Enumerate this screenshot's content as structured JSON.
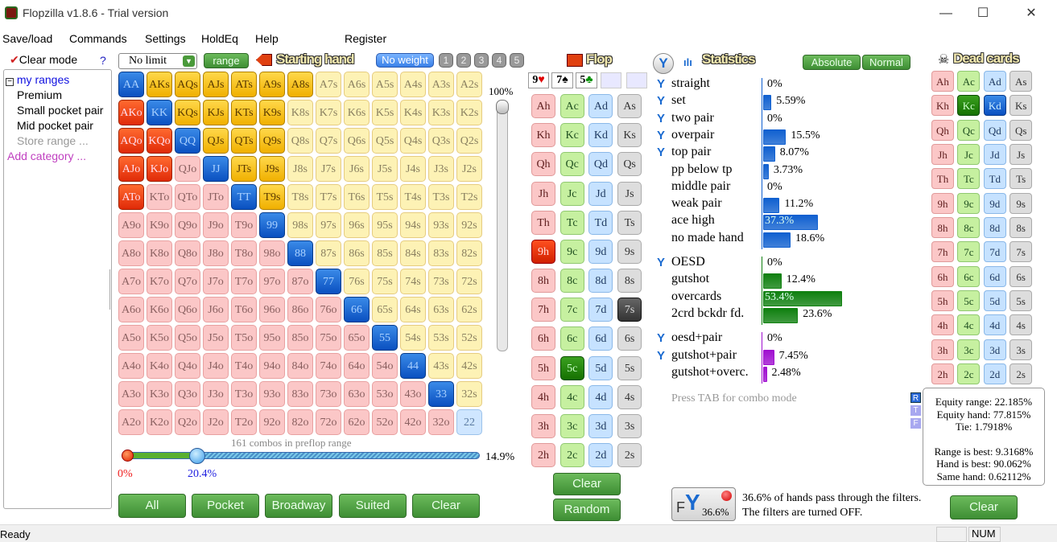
{
  "window": {
    "title": "Flopzilla v1.8.6 - Trial version",
    "minimize": "—",
    "maximize": "☐",
    "close": "✕"
  },
  "menu": [
    "Save/load",
    "Commands",
    "Settings",
    "HoldEq",
    "Help",
    "Register"
  ],
  "left": {
    "clear_mode": "Clear mode",
    "help": "?",
    "root": "my ranges",
    "items": [
      "Premium",
      "Small pocket pair",
      "Mid pocket pair"
    ],
    "store": "Store range ...",
    "add": "Add category ..."
  },
  "range_toolbar": {
    "game": "No limit",
    "range_btn": "range",
    "header": "Starting hand",
    "weight": "No weight",
    "weights": [
      "1",
      "2",
      "3",
      "4",
      "5"
    ],
    "slider_top": "100%"
  },
  "grid": {
    "ranks": [
      "A",
      "K",
      "Q",
      "J",
      "T",
      "9",
      "8",
      "7",
      "6",
      "5",
      "4",
      "3",
      "2"
    ],
    "selected": [
      "AA",
      "KK",
      "QQ",
      "JJ",
      "TT",
      "99",
      "88",
      "77",
      "66",
      "55",
      "44",
      "33",
      "AKs",
      "AQs",
      "AJs",
      "ATs",
      "A9s",
      "A8s",
      "KQs",
      "KJs",
      "KTs",
      "K9s",
      "QJs",
      "QTs",
      "Q9s",
      "JTs",
      "J9s",
      "T9s",
      "AKo",
      "AQo",
      "KQo",
      "AJo",
      "KJo",
      "ATo"
    ]
  },
  "combos_text": "161 combos in preflop range",
  "range_slider": {
    "low": "0%",
    "high": "20.4%",
    "value": "14.9%",
    "low_value": 0,
    "high_value": 20.4
  },
  "range_buttons": [
    "All",
    "Pocket",
    "Broadway",
    "Suited",
    "Clear"
  ],
  "flop": {
    "header": "Flop",
    "board": [
      {
        "rank": "9",
        "suit": "♥",
        "color": "#e00000"
      },
      {
        "rank": "7",
        "suit": "♠",
        "color": "#000"
      },
      {
        "rank": "5",
        "suit": "♣",
        "color": "#009000"
      }
    ],
    "ranks": [
      "A",
      "K",
      "Q",
      "J",
      "T",
      "9",
      "8",
      "7",
      "6",
      "5",
      "4",
      "3",
      "2"
    ],
    "suits": [
      "h",
      "c",
      "d",
      "s"
    ],
    "selected": [
      "9h",
      "5c",
      "7s"
    ],
    "clear": "Clear",
    "random": "Random"
  },
  "statistics": {
    "header": "Statistics",
    "absolute": "Absolute",
    "normal": "Normal",
    "groups": [
      {
        "color": "#1060d0",
        "rows": [
          {
            "label": "straight",
            "value": "0%",
            "pct": 0,
            "filter": true
          },
          {
            "label": "set",
            "value": "5.59%",
            "pct": 5.59,
            "filter": true
          },
          {
            "label": "two pair",
            "value": "0%",
            "pct": 0,
            "filter": true
          },
          {
            "label": "overpair",
            "value": "15.5%",
            "pct": 15.5,
            "filter": true
          },
          {
            "label": "top pair",
            "value": "8.07%",
            "pct": 8.07,
            "filter": true
          },
          {
            "label": "pp below tp",
            "value": "3.73%",
            "pct": 3.73,
            "filter": false
          },
          {
            "label": "middle pair",
            "value": "0%",
            "pct": 0,
            "filter": false
          },
          {
            "label": "weak pair",
            "value": "11.2%",
            "pct": 11.2,
            "filter": false
          },
          {
            "label": "ace high",
            "value": "37.3%",
            "pct": 37.3,
            "filter": false
          },
          {
            "label": "no made hand",
            "value": "18.6%",
            "pct": 18.6,
            "filter": false
          }
        ]
      },
      {
        "color": "#108010",
        "rows": [
          {
            "label": "OESD",
            "value": "0%",
            "pct": 0,
            "filter": true
          },
          {
            "label": "gutshot",
            "value": "12.4%",
            "pct": 12.4,
            "filter": false
          },
          {
            "label": "overcards",
            "value": "53.4%",
            "pct": 53.4,
            "filter": false
          },
          {
            "label": "2crd bckdr fd.",
            "value": "23.6%",
            "pct": 23.6,
            "filter": false
          }
        ]
      },
      {
        "color": "#a010d0",
        "rows": [
          {
            "label": "oesd+pair",
            "value": "0%",
            "pct": 0,
            "filter": true
          },
          {
            "label": "gutshot+pair",
            "value": "7.45%",
            "pct": 7.45,
            "filter": true
          },
          {
            "label": "gutshot+overc.",
            "value": "2.48%",
            "pct": 2.48,
            "filter": false
          }
        ]
      }
    ],
    "hint": "Press TAB for combo mode"
  },
  "dead": {
    "header": "Dead cards",
    "selected": [
      "Kc",
      "Kd"
    ]
  },
  "equity": {
    "tabs": [
      "R",
      "T",
      "F"
    ],
    "lines": [
      "Equity range: 22.185%",
      "Equity hand: 77.815%",
      "Tie: 1.7918%",
      "",
      "Range is best: 9.3168%",
      "Hand is best: 90.062%",
      "Same hand: 0.62112%"
    ]
  },
  "filter": {
    "badge": "36.6%",
    "line1": "36.6% of hands pass through the filters.",
    "line2": "The filters are turned OFF.",
    "clear": "Clear"
  },
  "status": {
    "text": "Ready",
    "num": "NUM"
  }
}
